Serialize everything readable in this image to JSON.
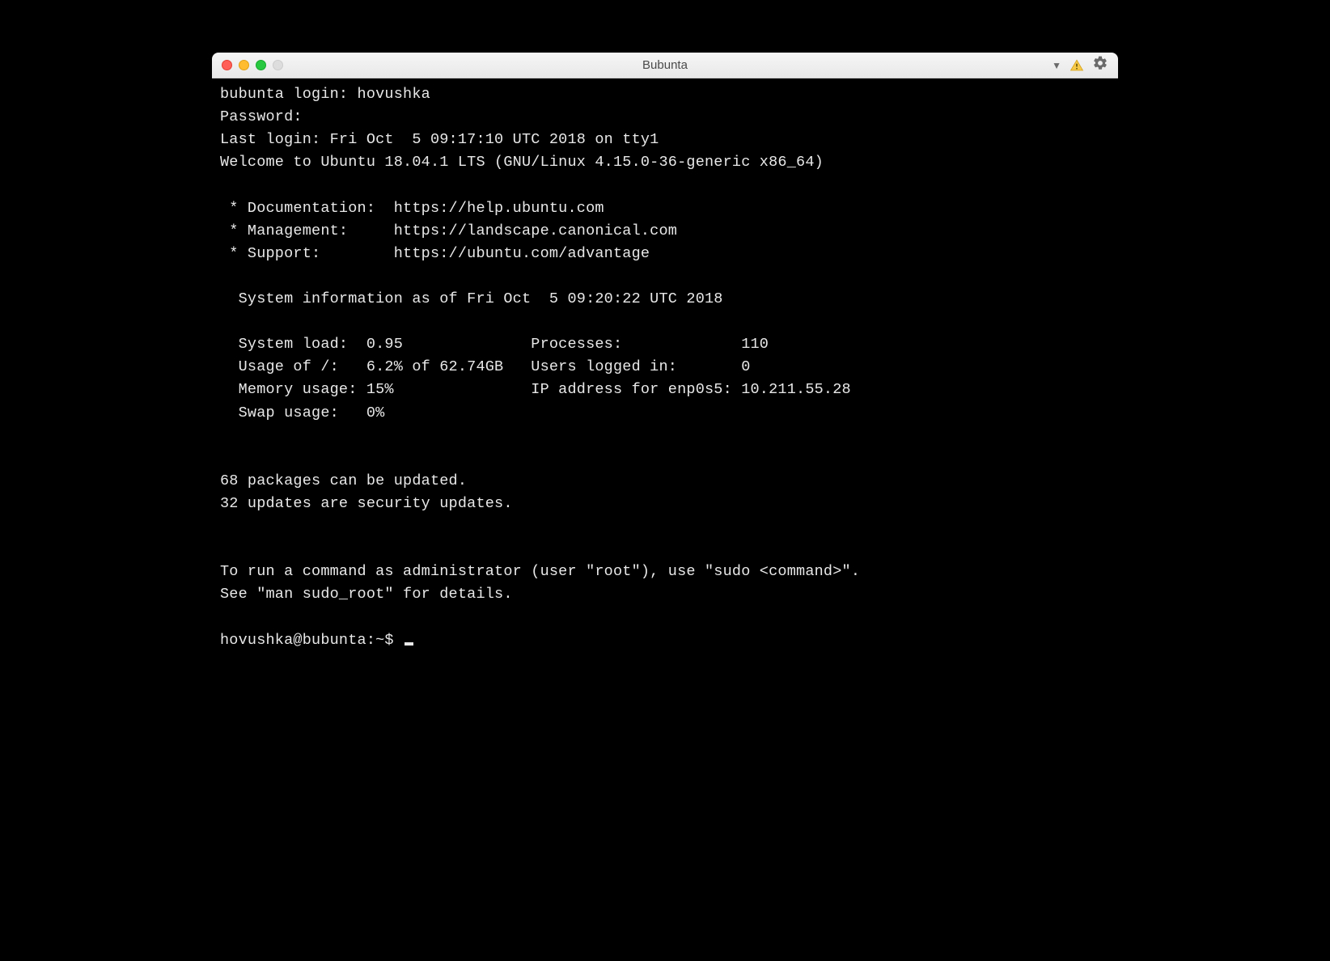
{
  "window": {
    "title": "Bubunta"
  },
  "terminal": {
    "lines": [
      "bubunta login: hovushka",
      "Password:",
      "Last login: Fri Oct  5 09:17:10 UTC 2018 on tty1",
      "Welcome to Ubuntu 18.04.1 LTS (GNU/Linux 4.15.0-36-generic x86_64)",
      "",
      " * Documentation:  https://help.ubuntu.com",
      " * Management:     https://landscape.canonical.com",
      " * Support:        https://ubuntu.com/advantage",
      "",
      "  System information as of Fri Oct  5 09:20:22 UTC 2018",
      "",
      "  System load:  0.95              Processes:             110",
      "  Usage of /:   6.2% of 62.74GB   Users logged in:       0",
      "  Memory usage: 15%               IP address for enp0s5: 10.211.55.28",
      "  Swap usage:   0%",
      "",
      "",
      "68 packages can be updated.",
      "32 updates are security updates.",
      "",
      "",
      "To run a command as administrator (user \"root\"), use \"sudo <command>\".",
      "See \"man sudo_root\" for details.",
      ""
    ],
    "prompt": "hovushka@bubunta:~$ "
  }
}
